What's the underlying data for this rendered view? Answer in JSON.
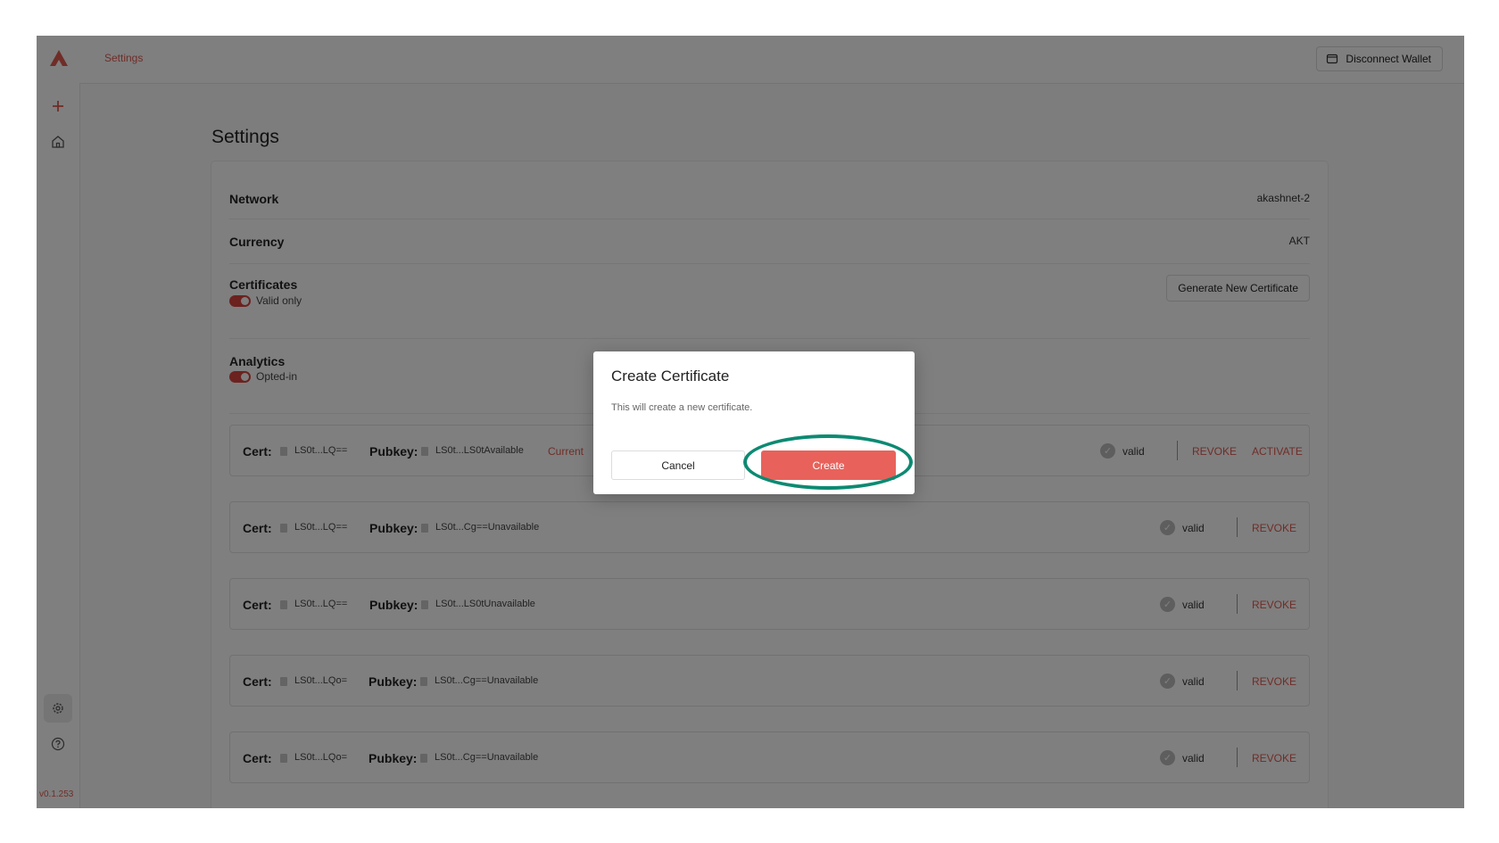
{
  "header": {
    "breadcrumb": "Settings",
    "disconnect_label": "Disconnect Wallet",
    "logo_icon": "akash-logo-icon",
    "accent_color": "#e05a50"
  },
  "sidebar": {
    "items": [
      {
        "icon": "plus-icon"
      },
      {
        "icon": "home-icon"
      },
      {
        "icon": "gear-icon"
      },
      {
        "icon": "help-icon"
      }
    ],
    "version": "v0.1.253"
  },
  "main": {
    "title": "Settings",
    "network": {
      "label": "Network",
      "value": "akashnet-2"
    },
    "currency": {
      "label": "Currency",
      "value": "AKT"
    },
    "certificates": {
      "label": "Certificates",
      "toggle_label": "Valid only",
      "generate_label": "Generate New Certificate"
    },
    "analytics": {
      "label": "Analytics",
      "toggle_label": "Opted-in"
    },
    "certs": [
      {
        "cert_label": "Cert:",
        "cert": "LS0t...LQ==",
        "pubkey_label": "Pubkey:",
        "pubkey": "LS0t...LS0tAvailable",
        "current": "Current",
        "status": "valid",
        "revoke": "REVOKE",
        "activate": "ACTIVATE"
      },
      {
        "cert_label": "Cert:",
        "cert": "LS0t...LQ==",
        "pubkey_label": "Pubkey:",
        "pubkey": "LS0t...Cg==Unavailable",
        "status": "valid",
        "revoke": "REVOKE"
      },
      {
        "cert_label": "Cert:",
        "cert": "LS0t...LQ==",
        "pubkey_label": "Pubkey:",
        "pubkey": "LS0t...LS0tUnavailable",
        "status": "valid",
        "revoke": "REVOKE"
      },
      {
        "cert_label": "Cert:",
        "cert": "LS0t...LQo=",
        "pubkey_label": "Pubkey:",
        "pubkey": "LS0t...Cg==Unavailable",
        "status": "valid",
        "revoke": "REVOKE"
      },
      {
        "cert_label": "Cert:",
        "cert": "LS0t...LQo=",
        "pubkey_label": "Pubkey:",
        "pubkey": "LS0t...Cg==Unavailable",
        "status": "valid",
        "revoke": "REVOKE"
      }
    ]
  },
  "dialog": {
    "title": "Create Certificate",
    "text": "This will create a new certificate.",
    "cancel_label": "Cancel",
    "create_label": "Create",
    "create_color": "#e8625b",
    "highlight_color": "#0c8a72"
  }
}
